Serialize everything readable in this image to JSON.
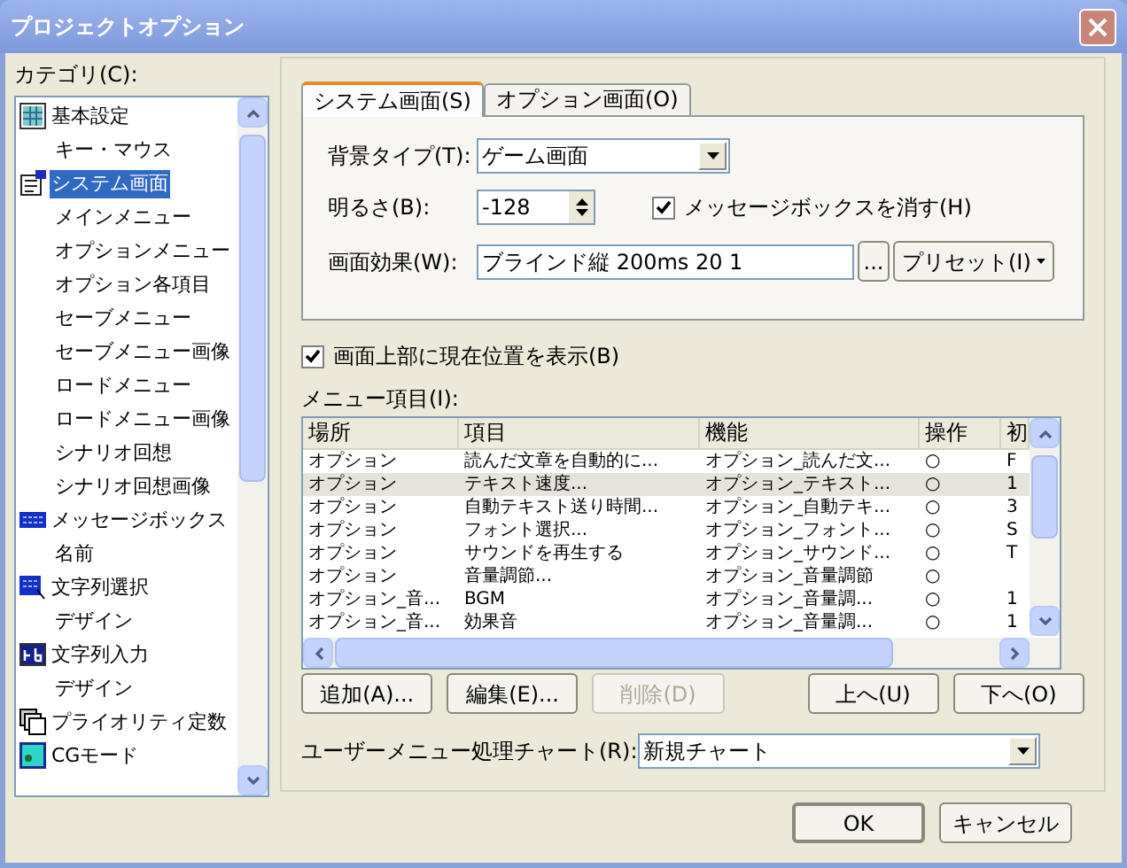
{
  "window": {
    "title": "プロジェクトオプション"
  },
  "category": {
    "label": "カテゴリ(C):",
    "items": [
      {
        "label": "基本設定",
        "kind": "grid",
        "selected": false,
        "children": [
          {
            "label": "キー・マウス",
            "selected": false
          }
        ]
      },
      {
        "label": "システム画面",
        "kind": "form",
        "selected": true,
        "children": [
          {
            "label": "メインメニュー",
            "selected": false
          },
          {
            "label": "オプションメニュー",
            "selected": false
          },
          {
            "label": "オプション各項目",
            "selected": false
          },
          {
            "label": "セーブメニュー",
            "selected": false
          },
          {
            "label": "セーブメニュー画像",
            "selected": false
          },
          {
            "label": "ロードメニュー",
            "selected": false
          },
          {
            "label": "ロードメニュー画像",
            "selected": false
          },
          {
            "label": "シナリオ回想",
            "selected": false
          },
          {
            "label": "シナリオ回想画像",
            "selected": false
          }
        ]
      },
      {
        "label": "メッセージボックス",
        "kind": "message",
        "selected": false,
        "children": [
          {
            "label": "名前",
            "selected": false
          }
        ]
      },
      {
        "label": "文字列選択",
        "kind": "select",
        "selected": false,
        "children": [
          {
            "label": "デザイン",
            "selected": false
          }
        ]
      },
      {
        "label": "文字列入力",
        "kind": "input",
        "selected": false,
        "children": [
          {
            "label": "デザイン",
            "selected": false
          }
        ]
      },
      {
        "label": "プライオリティ定数",
        "kind": "layers",
        "selected": false
      },
      {
        "label": "CGモード",
        "kind": "image",
        "selected": false
      }
    ]
  },
  "tabs": [
    {
      "label": "システム画面(S)",
      "selected": true
    },
    {
      "label": "オプション画面(O)",
      "selected": false
    }
  ],
  "background_type": {
    "label": "背景タイプ(T):",
    "value": "ゲーム画面"
  },
  "brightness": {
    "label": "明るさ(B):",
    "value": "-128"
  },
  "hide_message_box": {
    "label": "メッセージボックスを消す(H)",
    "checked": true
  },
  "screen_effect": {
    "label": "画面効果(W):",
    "value": "ブラインド縦 200ms 20 1",
    "browse": "...",
    "preset": "プリセット(I)"
  },
  "show_position": {
    "label": "画面上部に現在位置を表示(B)",
    "checked": true
  },
  "menu_items": {
    "label": "メニュー項目(I):",
    "columns": [
      "場所",
      "項目",
      "機能",
      "操作",
      "初"
    ],
    "rows": [
      {
        "cells": [
          "オプション",
          "読んだ文章を自動的に...",
          "オプション_読んだ文...",
          "○",
          "F"
        ],
        "selected": false
      },
      {
        "cells": [
          "オプション",
          "テキスト速度...",
          "オプション_テキスト...",
          "○",
          "1"
        ],
        "selected": true
      },
      {
        "cells": [
          "オプション",
          "自動テキスト送り時間...",
          "オプション_自動テキ...",
          "○",
          "3"
        ],
        "selected": false
      },
      {
        "cells": [
          "オプション",
          "フォント選択...",
          "オプション_フォント...",
          "○",
          "S"
        ],
        "selected": false
      },
      {
        "cells": [
          "オプション",
          "サウンドを再生する",
          "オプション_サウンド...",
          "○",
          "T"
        ],
        "selected": false
      },
      {
        "cells": [
          "オプション",
          "音量調節...",
          "オプション_音量調節",
          "○"
        ],
        "selected": false
      },
      {
        "cells": [
          "オプション_音...",
          "BGM",
          "オプション_音量調...",
          "○",
          "1"
        ],
        "selected": false
      },
      {
        "cells": [
          "オプション_音...",
          "効果音",
          "オプション_音量調...",
          "○",
          "1"
        ],
        "selected": false
      }
    ]
  },
  "list_buttons": [
    {
      "label": "追加(A)...",
      "disabled": false
    },
    {
      "label": "編集(E)...",
      "disabled": false
    },
    {
      "label": "削除(D)",
      "disabled": true
    },
    {
      "label": "上へ(U)",
      "disabled": false
    },
    {
      "label": "下へ(O)",
      "disabled": false
    }
  ],
  "user_menu_chart": {
    "label": "ユーザーメニュー処理チャート(R):",
    "value": "新規チャート"
  },
  "buttons": [
    {
      "label": "OK",
      "default": true
    },
    {
      "label": "キャンセル",
      "default": false
    }
  ]
}
